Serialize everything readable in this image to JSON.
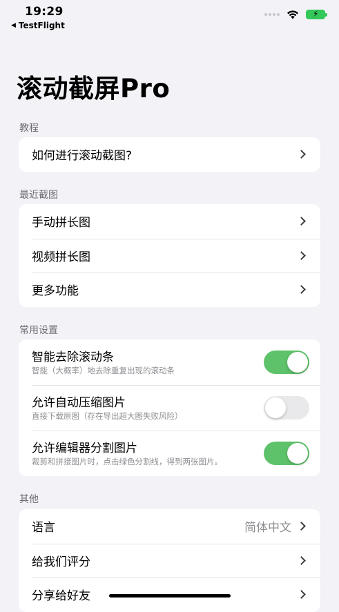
{
  "status": {
    "time": "19:29",
    "back_app": "TestFlight"
  },
  "title": "滚动截屏Pro",
  "sections": {
    "tutorial": {
      "header": "教程",
      "items": [
        {
          "label": "如何进行滚动截图?"
        }
      ]
    },
    "recent": {
      "header": "最近截图",
      "items": [
        {
          "label": "手动拼长图"
        },
        {
          "label": "视频拼长图"
        },
        {
          "label": "更多功能"
        }
      ]
    },
    "settings": {
      "header": "常用设置",
      "items": [
        {
          "title": "智能去除滚动条",
          "desc": "智能（大概率）地去除重复出现的滚动条",
          "on": true
        },
        {
          "title": "允许自动压缩图片",
          "desc": "直接下载原图（存在导出超大图失败风险）",
          "on": false
        },
        {
          "title": "允许编辑器分割图片",
          "desc": "裁剪和拼接图片时，点击绿色分割线，得到两张图片。",
          "on": true
        }
      ]
    },
    "other": {
      "header": "其他",
      "items": [
        {
          "label": "语言",
          "value": "简体中文"
        },
        {
          "label": "给我们评分"
        },
        {
          "label": "分享给好友"
        }
      ]
    }
  },
  "colors": {
    "toggle_on": "#5ec26a",
    "background": "#f2f2f7"
  }
}
